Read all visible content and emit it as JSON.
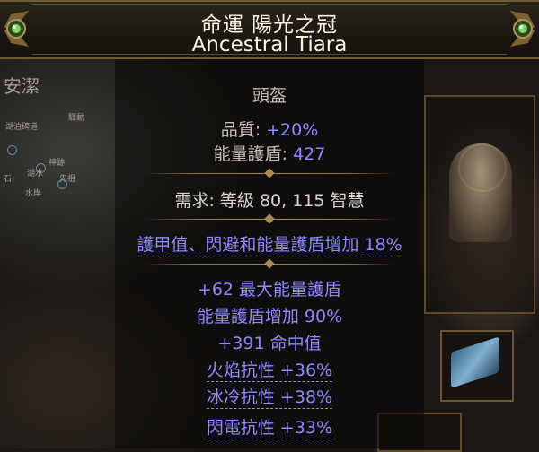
{
  "item": {
    "name_line1": "命運 陽光之冠",
    "name_line2": "Ancestral Tiara",
    "item_class": "頭盔",
    "quality_label": "品質: ",
    "quality_value": "+20%",
    "es_label": "能量護盾: ",
    "es_value": "427",
    "requirements": "需求: 等級 80, 115 智慧",
    "implicit": "護甲值、閃避和能量護盾增加 18%",
    "mods": [
      "+62 最大能量護盾",
      "能量護盾增加 90%",
      "+391 命中值",
      "火焰抗性 +36%",
      "冰冷抗性 +38%",
      "閃電抗性 +33%"
    ]
  },
  "background": {
    "map_area_label": "安潔",
    "map_labels": [
      "驛動",
      "湖泊碑道",
      "神跡",
      "先祖",
      "湖水",
      "石",
      "水岸"
    ]
  },
  "colors": {
    "unique_name": "#fdf6e3",
    "magic_mod": "#8c8cff",
    "default_text": "#c4c0bc",
    "frame_gold": "#8c7443"
  }
}
